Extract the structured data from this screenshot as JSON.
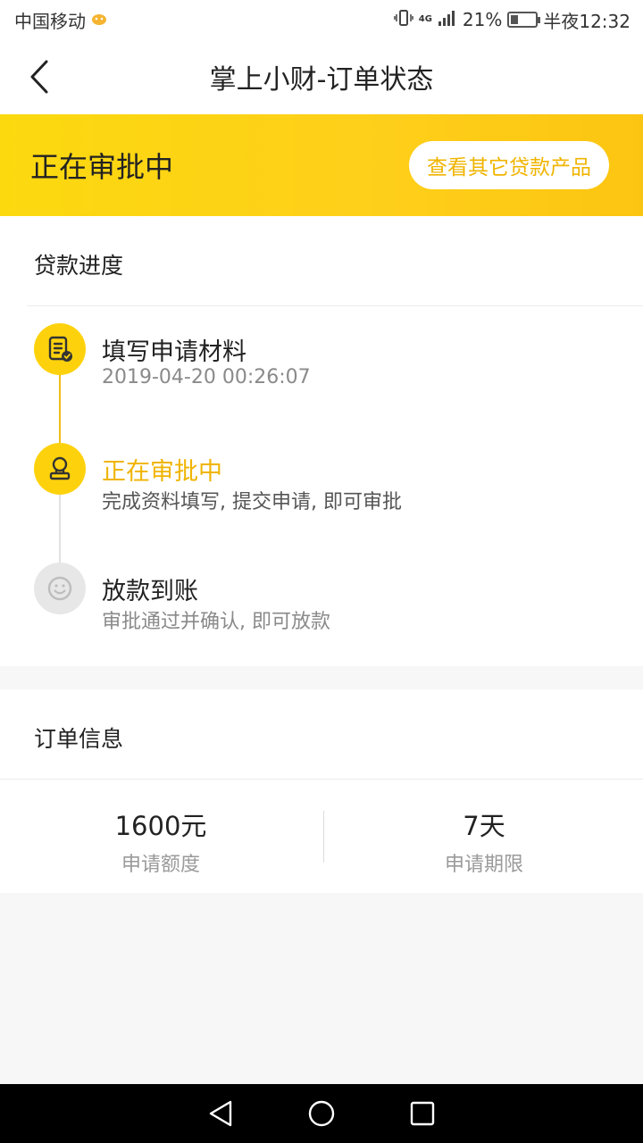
{
  "status_bar": {
    "carrier": "中国移动",
    "network": "4G",
    "battery": "21%",
    "time": "半夜12:32"
  },
  "nav": {
    "title": "掌上小财-订单状态"
  },
  "banner": {
    "status": "正在审批中",
    "other_products_button": "查看其它贷款产品"
  },
  "progress": {
    "title": "贷款进度",
    "steps": [
      {
        "title": "填写申请材料",
        "subtitle": "2019-04-20 00:26:07",
        "icon": "document-check-icon",
        "state": "done"
      },
      {
        "title": "正在审批中",
        "subtitle": "完成资料填写, 提交申请, 即可审批",
        "icon": "stamp-icon",
        "state": "active"
      },
      {
        "title": "放款到账",
        "subtitle": "审批通过并确认, 即可放款",
        "icon": "smiley-icon",
        "state": "pending"
      }
    ]
  },
  "order": {
    "title": "订单信息",
    "amount_value": "1600元",
    "amount_label": "申请额度",
    "term_value": "7天",
    "term_label": "申请期限"
  },
  "colors": {
    "accent": "#f0b400",
    "banner": "#fdd20d",
    "pending": "#e7e7e7"
  }
}
